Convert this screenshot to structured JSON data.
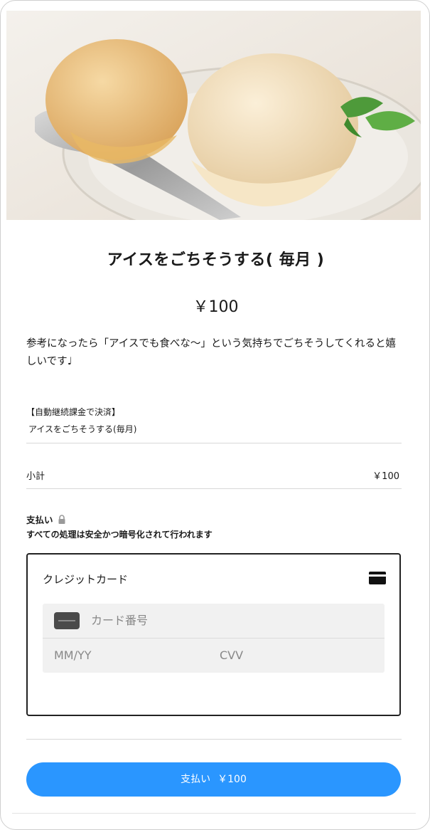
{
  "product": {
    "title": "アイスをごちそうする( 毎月 )",
    "price": "￥100",
    "description": "参考になったら「アイスでも食べな〜」という気持ちでごちそうしてくれると嬉しいです♩"
  },
  "billing": {
    "label": "【自動継続課金で決済】",
    "item": "アイスをごちそうする(毎月)"
  },
  "subtotal": {
    "label": "小計",
    "value": "￥100"
  },
  "payment": {
    "heading": "支払い",
    "secure_note": "すべての処理は安全かつ暗号化されて行われます",
    "method_label": "クレジットカード",
    "card_number_placeholder": "カード番号",
    "expiry_placeholder": "MM/YY",
    "cvv_placeholder": "CVV",
    "button_label": "支払い",
    "button_amount": "￥100"
  },
  "icons": {
    "lock": "lock-icon",
    "credit_card": "credit-card-icon",
    "card_chip": "card-chip-icon"
  },
  "colors": {
    "accent": "#2a96ff",
    "text": "#1a1a1a",
    "field_bg": "#f1f1f1",
    "muted": "#888888"
  }
}
